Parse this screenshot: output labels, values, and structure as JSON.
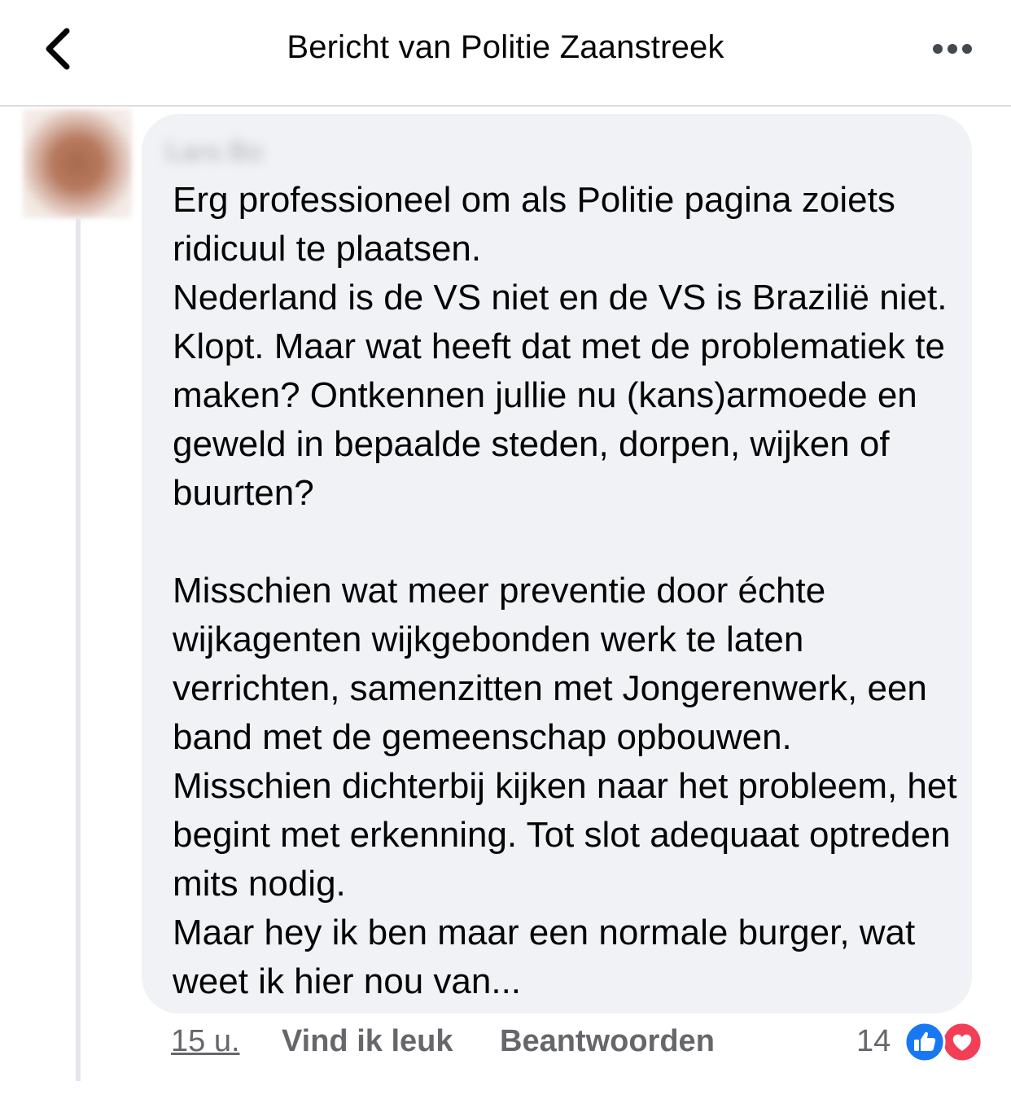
{
  "header": {
    "title": "Bericht van Politie Zaanstreek",
    "back_icon": "chevron-left-icon",
    "more_icon": "more-horizontal-icon"
  },
  "comment": {
    "author": "Lars Bo",
    "paragraphs": [
      "Erg professioneel om als Politie pagina zoiets ridicuul te plaatsen.",
      "Nederland is de VS niet en de VS is Brazilië niet. Klopt. Maar wat heeft dat met de problematiek te maken? Ontkennen jullie nu (kans)armoede en geweld in bepaalde steden, dorpen, wijken of buurten?",
      "",
      "Misschien wat meer preventie door échte wijkagenten wijkgebonden werk te laten verrichten, samenzitten met Jongerenwerk, een band met de gemeenschap opbouwen.",
      "Misschien dichterbij kijken naar het probleem, het begint met erkenning. Tot slot adequaat optreden mits nodig.",
      "Maar hey ik ben maar een normale burger, wat weet ik hier nou van..."
    ]
  },
  "actions": {
    "timestamp": "15 u.",
    "like_label": "Vind ik leuk",
    "reply_label": "Beantwoorden"
  },
  "reactions": {
    "count": "14",
    "types": [
      "like-icon",
      "love-icon"
    ],
    "like_color": "#1877f2",
    "love_color": "#f33e58"
  }
}
